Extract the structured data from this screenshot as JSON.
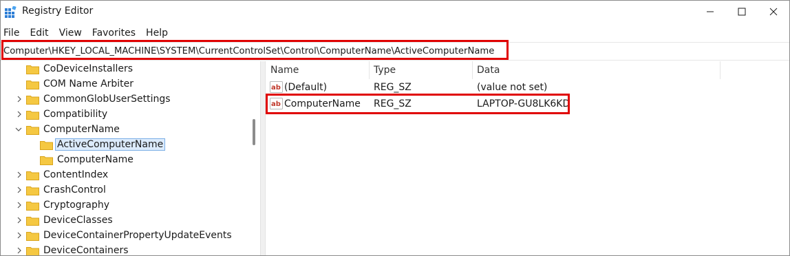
{
  "window": {
    "title": "Registry Editor"
  },
  "menu": [
    "File",
    "Edit",
    "View",
    "Favorites",
    "Help"
  ],
  "address": {
    "path": "Computer\\HKEY_LOCAL_MACHINE\\SYSTEM\\CurrentControlSet\\Control\\ComputerName\\ActiveComputerName"
  },
  "tree": {
    "items": [
      {
        "label": "CoDeviceInstallers",
        "expandable": false
      },
      {
        "label": "COM Name Arbiter",
        "expandable": false
      },
      {
        "label": "CommonGlobUserSettings",
        "expandable": true
      },
      {
        "label": "Compatibility",
        "expandable": true
      },
      {
        "label": "ComputerName",
        "expandable": true,
        "expanded": true
      },
      {
        "label": "ActiveComputerName",
        "child": true,
        "selected": true
      },
      {
        "label": "ComputerName",
        "child": true
      },
      {
        "label": "ContentIndex",
        "expandable": true
      },
      {
        "label": "CrashControl",
        "expandable": true
      },
      {
        "label": "Cryptography",
        "expandable": true
      },
      {
        "label": "DeviceClasses",
        "expandable": true
      },
      {
        "label": "DeviceContainerPropertyUpdateEvents",
        "expandable": true
      },
      {
        "label": "DeviceContainers",
        "expandable": true
      }
    ]
  },
  "list": {
    "columns": [
      "Name",
      "Type",
      "Data"
    ],
    "rows": [
      {
        "name": "(Default)",
        "type": "REG_SZ",
        "data": "(value not set)"
      },
      {
        "name": "ComputerName",
        "type": "REG_SZ",
        "data": "LAPTOP-GU8LK6KD"
      }
    ]
  },
  "colors": {
    "highlight": "#e00000",
    "folder": "#f5c842",
    "selection": "#dcebfc"
  },
  "icons": {
    "app": "registry-editor-icon",
    "folder": "folder-icon",
    "value": "string-value-icon"
  }
}
